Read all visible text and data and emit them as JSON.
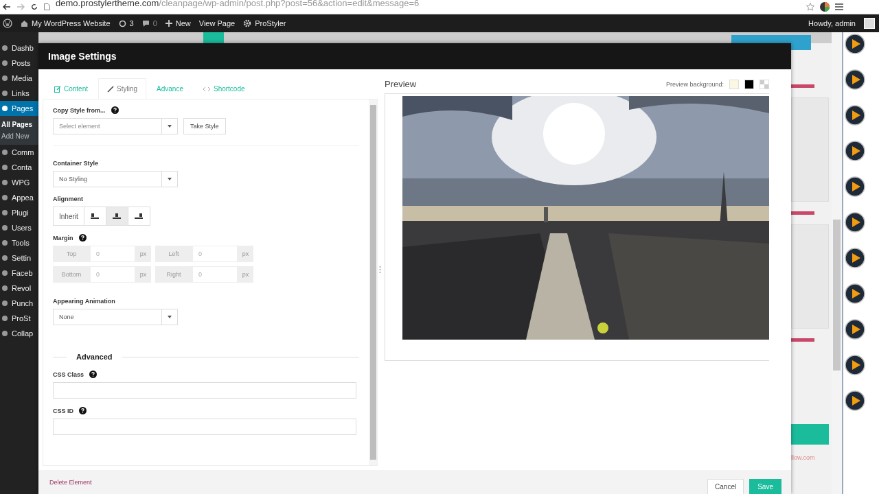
{
  "browser": {
    "url_host": "demo.prostylertheme.com",
    "url_path": "/cleanpage/wp-admin/post.php?post=56&action=edit&message=6"
  },
  "admin_bar": {
    "site": "My WordPress Website",
    "updates": "3",
    "comments": "0",
    "new": "New",
    "view": "View Page",
    "plugin": "ProStyler",
    "greeting": "Howdy, admin"
  },
  "sidebar": {
    "items": [
      {
        "label": "Dashb",
        "selected": false
      },
      {
        "label": "Posts",
        "selected": false
      },
      {
        "label": "Media",
        "selected": false
      },
      {
        "label": "Links",
        "selected": false
      },
      {
        "label": "Pages",
        "selected": true,
        "children": [
          {
            "label": "All Pages",
            "selected": true
          },
          {
            "label": "Add New",
            "selected": false
          }
        ]
      },
      {
        "label": "Comm",
        "selected": false
      },
      {
        "label": "Conta",
        "selected": false
      },
      {
        "label": "WPG",
        "selected": false
      },
      {
        "label": "Appea",
        "selected": false
      },
      {
        "label": "Plugi",
        "selected": false
      },
      {
        "label": "Users",
        "selected": false
      },
      {
        "label": "Tools",
        "selected": false
      },
      {
        "label": "Settin",
        "selected": false
      },
      {
        "label": "Faceb",
        "selected": false
      },
      {
        "label": "Revol",
        "selected": false
      },
      {
        "label": "Punch",
        "selected": false
      },
      {
        "label": "ProSt",
        "selected": false
      },
      {
        "label": "Collap",
        "selected": false
      }
    ]
  },
  "background_page": {
    "link_text": "llow.com"
  },
  "modal": {
    "title": "Image Settings",
    "tabs": [
      {
        "label": "Content",
        "kind": "edit",
        "selected": false
      },
      {
        "label": "Styling",
        "kind": "brush",
        "selected": true
      },
      {
        "label": "Advance",
        "kind": "none",
        "selected": false
      },
      {
        "label": "Shortcode",
        "kind": "code",
        "selected": false
      }
    ],
    "copy_style": {
      "label": "Copy Style from...",
      "placeholder": "Select element",
      "button": "Take Style"
    },
    "container_style": {
      "label": "Container Style",
      "value": "No Styling"
    },
    "alignment": {
      "label": "Alignment",
      "options": [
        {
          "kind": "text",
          "label": "Inherit",
          "selected": false
        },
        {
          "kind": "left",
          "selected": false
        },
        {
          "kind": "center",
          "selected": true
        },
        {
          "kind": "right",
          "selected": false
        }
      ]
    },
    "margin": {
      "label": "Margin",
      "sides": [
        {
          "label": "Top",
          "placeholder": "0",
          "unit": "px"
        },
        {
          "label": "Left",
          "placeholder": "0",
          "unit": "px"
        },
        {
          "label": "Bottom",
          "placeholder": "0",
          "unit": "px"
        },
        {
          "label": "Right",
          "placeholder": "0",
          "unit": "px"
        }
      ]
    },
    "animation": {
      "label": "Appearing Animation",
      "value": "None"
    },
    "advanced": {
      "heading": "Advanced",
      "css_class_label": "CSS Class",
      "css_id_label": "CSS ID"
    },
    "preview": {
      "title": "Preview",
      "background_label": "Preview background:",
      "swatches": [
        {
          "kind": "solid",
          "color": "#fbf7e3"
        },
        {
          "kind": "solid",
          "color": "#000000"
        },
        {
          "kind": "transparent"
        }
      ]
    },
    "footer": {
      "delete": "Delete Element",
      "cancel": "Cancel",
      "save": "Save"
    }
  }
}
